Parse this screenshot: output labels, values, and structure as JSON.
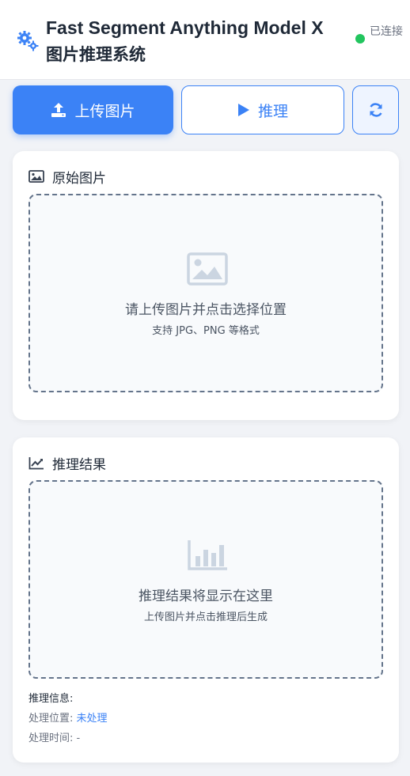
{
  "header": {
    "title": "Fast Segment Anything Model X",
    "subtitle": "图片推理系统",
    "status_text": "已连接",
    "status_color": "#22c55e",
    "icon": "gears-icon"
  },
  "toolbar": {
    "upload_label": "上传图片",
    "upload_icon": "upload-icon",
    "infer_label": "推理",
    "infer_icon": "play-icon",
    "refresh_icon": "refresh-icon",
    "accent": "#3b82f6"
  },
  "original": {
    "title": "原始图片",
    "icon": "image-icon",
    "placeholder_main": "请上传图片并点击选择位置",
    "placeholder_sub": "支持 JPG、PNG 等格式"
  },
  "result": {
    "title": "推理结果",
    "icon": "chart-line-icon",
    "placeholder_main": "推理结果将显示在这里",
    "placeholder_sub": "上传图片并点击推理后生成",
    "info_label": "推理信息:",
    "position_label": "处理位置:",
    "position_value": "未处理",
    "time_label": "处理时间:",
    "time_value": "-"
  }
}
